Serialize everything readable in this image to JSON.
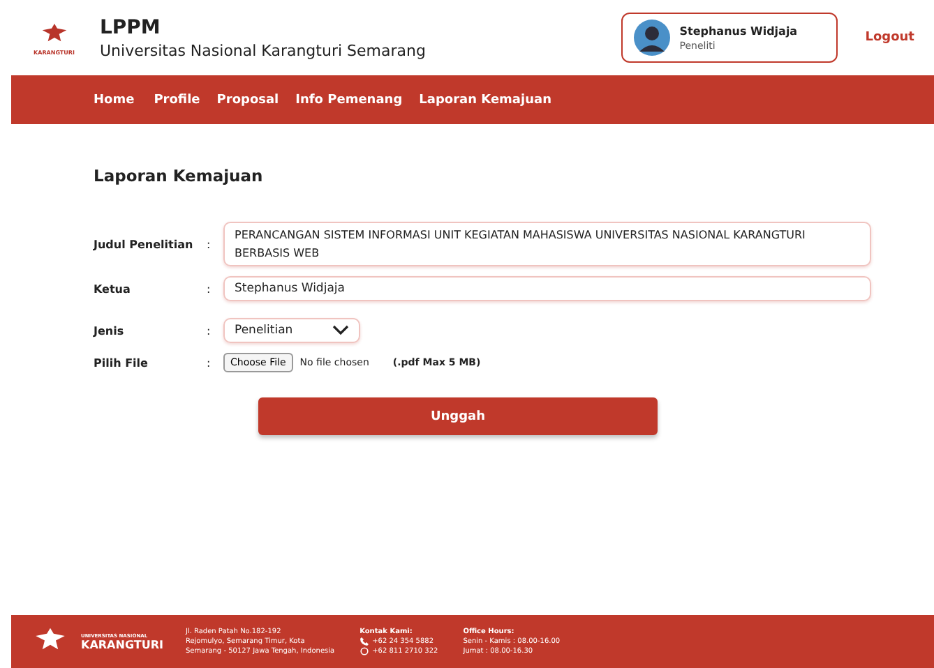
{
  "header": {
    "logo_text": "KARANGTURI",
    "title": "LPPM",
    "subtitle": "Universitas Nasional Karangturi Semarang",
    "user": {
      "name": "Stephanus Widjaja",
      "role": "Peneliti"
    },
    "logout": "Logout"
  },
  "nav": [
    {
      "label": "Home"
    },
    {
      "label": "Profile"
    },
    {
      "label": "Proposal"
    },
    {
      "label": "Info Pemenang"
    },
    {
      "label": "Laporan Kemajuan"
    }
  ],
  "page_title": "Laporan Kemajuan",
  "form": [
    {
      "kind": "textarea",
      "label": "Judul Penelitian",
      "sep": ":",
      "value": "PERANCANGAN SISTEM INFORMASI UNIT KEGIATAN MAHASISWA UNIVERSITAS NASIONAL KARANGTURI BERBASIS WEB"
    },
    {
      "kind": "text",
      "label": "Ketua",
      "sep": ":",
      "value": "Stephanus Widjaja"
    },
    {
      "kind": "select",
      "label": "Jenis",
      "sep": ":",
      "value": "Penelitian"
    },
    {
      "kind": "file",
      "label": "Pilih File",
      "sep": ":",
      "button": "Choose File",
      "status": "No file chosen",
      "hint": "(.pdf Max 5 MB)"
    }
  ],
  "submit": "Unggah",
  "footer": {
    "logo_top": "UNIVERSITAS NASIONAL",
    "logo_name": "KARANGTURI",
    "address": [
      "Jl. Raden Patah No.182-192",
      "Rejomulyo, Semarang Timur, Kota",
      "Semarang - 50127 Jawa Tengah, Indonesia"
    ],
    "contact_title": "Kontak Kami:",
    "phone": "+62 24 354 5882",
    "whatsapp": "+62 811 2710 322",
    "hours_title": "Office Hours:",
    "hours": [
      "Senin - Kamis : 08.00-16.00",
      "Jumat : 08.00-16.30"
    ]
  }
}
